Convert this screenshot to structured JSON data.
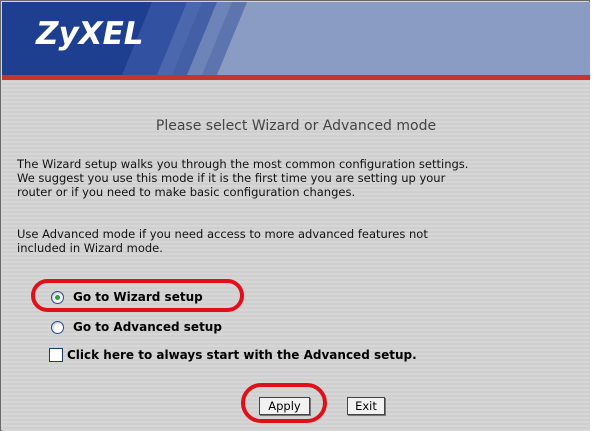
{
  "header": {
    "logo": "ZyXEL"
  },
  "main": {
    "title": "Please select Wizard or Advanced mode",
    "paragraph1_lines": [
      "The Wizard setup walks you through the most common configuration settings.",
      "We suggest you use this mode if it is the first time you are setting up your",
      "router or if you need to make basic configuration changes."
    ],
    "paragraph2_lines": [
      "Use Advanced mode if you need access to more advanced features not",
      "included in Wizard mode."
    ],
    "options": {
      "wizard_label": "Go to Wizard setup",
      "advanced_label": "Go to Advanced setup",
      "selected": "wizard"
    },
    "checkbox_label": "Click here to always start with the Advanced setup.",
    "checkbox_checked": false,
    "buttons": {
      "apply": "Apply",
      "exit": "Exit"
    }
  },
  "colors": {
    "header_blue": "#1e3f8f",
    "accent_red": "#c8322f",
    "highlight_red": "#e0101b"
  }
}
